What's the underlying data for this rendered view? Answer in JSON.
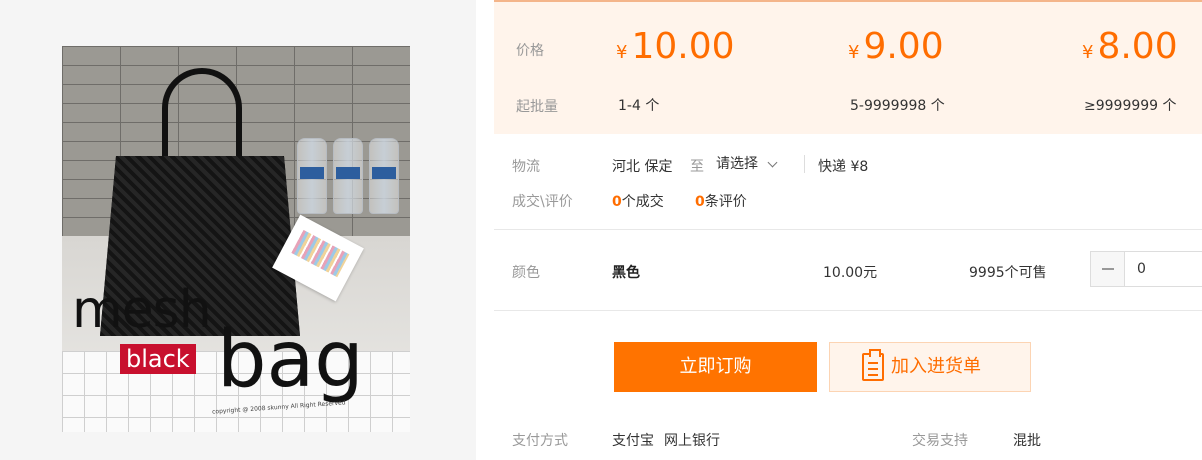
{
  "product_image": {
    "text_mesh": "mesh",
    "text_black": "black",
    "text_bag": "bag",
    "copyright": "copyright @ 2008 skunny All Right Reserved"
  },
  "price_box": {
    "price_label": "价格",
    "batch_label": "起批量",
    "currency": "¥",
    "tiers": [
      {
        "price": "10.00",
        "qty": "1-4 个"
      },
      {
        "price": "9.00",
        "qty": "5-9999998 个"
      },
      {
        "price": "8.00",
        "qty": "≥9999999 个"
      }
    ]
  },
  "logistics": {
    "label": "物流",
    "from": "河北 保定",
    "to_text": "至",
    "destination_placeholder": "请选择",
    "express": "快递 ¥8"
  },
  "deals": {
    "label": "成交\\评价",
    "deal_count": "0",
    "deal_suffix": "个成交",
    "review_count": "0",
    "review_suffix": "条评价"
  },
  "sku": {
    "label": "颜色",
    "color": "黑色",
    "unit_price": "10.00元",
    "stock": "9995个可售",
    "quantity": "0"
  },
  "actions": {
    "buy_now": "立即订购",
    "add_to_cart": "加入进货单"
  },
  "payment": {
    "label": "支付方式",
    "methods": [
      "支付宝",
      "网上银行"
    ],
    "trade_label": "交易支持",
    "trade_value": "混批"
  },
  "colors": {
    "accent": "#ff6d00",
    "button_bg": "#ff7300",
    "price_box_bg": "#fff4eb"
  }
}
